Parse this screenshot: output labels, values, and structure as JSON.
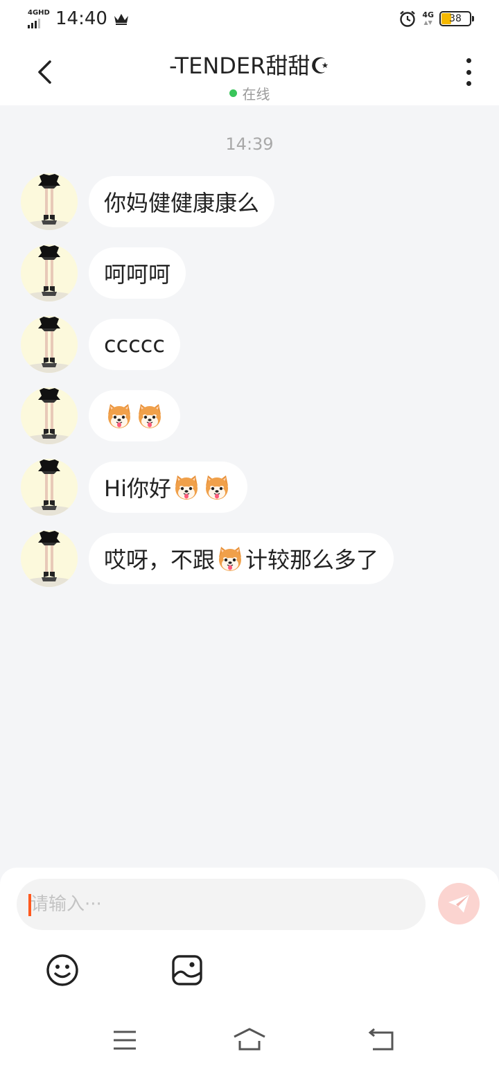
{
  "status_bar": {
    "network_left": "4GHD",
    "time": "14:40",
    "network_right": "4G",
    "battery": "38"
  },
  "header": {
    "contact_name": "-TENDER甜甜☪",
    "status": "在线"
  },
  "chat": {
    "timestamp": "14:39",
    "messages": [
      {
        "text": "你妈健健康康么"
      },
      {
        "text": "呵呵呵"
      },
      {
        "text": "ccccc"
      },
      {
        "text": "",
        "emoji_count": 2
      },
      {
        "text": "Hi你好",
        "emoji_count": 2
      },
      {
        "text_before": "哎呀，不跟",
        "text_after": "计较那么多了"
      }
    ]
  },
  "composer": {
    "placeholder": "请输入···"
  },
  "icons": {
    "back": "chevron-left-icon",
    "more": "more-vertical-icon",
    "send": "send-icon",
    "emoji": "smiley-icon",
    "image": "image-icon",
    "nav_menu": "menu-icon",
    "nav_home": "home-icon",
    "nav_back": "back-icon",
    "message_emoji": "shiba-dog-emoji"
  },
  "colors": {
    "background": "#f4f5f7",
    "bubble": "#ffffff",
    "online": "#39c55a",
    "send_button": "#fbd4d0",
    "caret": "#ff5a1f",
    "battery": "#f5b800"
  }
}
